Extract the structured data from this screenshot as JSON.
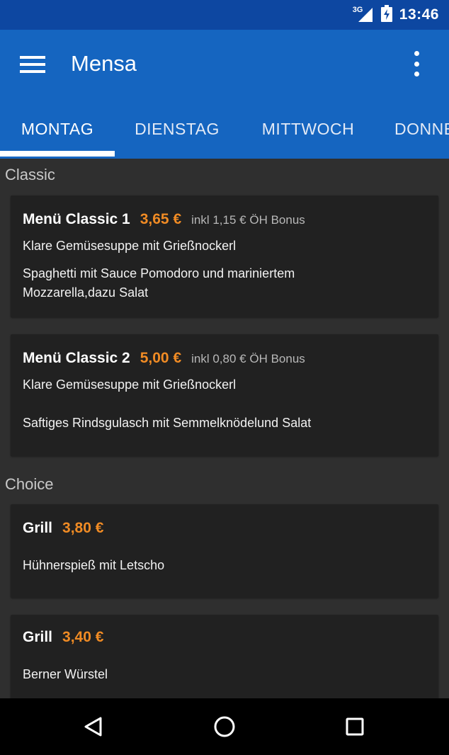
{
  "status_bar": {
    "network": "3G",
    "time": "13:46"
  },
  "app_bar": {
    "title": "Mensa",
    "menu_icon": "hamburger-menu-icon",
    "overflow_icon": "more-vertical-icon"
  },
  "tabs": [
    {
      "label": "MONTAG",
      "active": true
    },
    {
      "label": "DIENSTAG",
      "active": false
    },
    {
      "label": "MITTWOCH",
      "active": false
    },
    {
      "label": "DONNERSTAG",
      "active": false
    }
  ],
  "sections": [
    {
      "title": "Classic",
      "items": [
        {
          "name": "Menü Classic 1",
          "price": "3,65 €",
          "bonus": "inkl 1,15 € ÖH Bonus",
          "lines": [
            "Klare Gemüsesuppe mit Grießnockerl",
            "Spaghetti mit Sauce Pomodoro und mariniertem Mozzarella,dazu Salat"
          ]
        },
        {
          "name": "Menü Classic 2",
          "price": "5,00 €",
          "bonus": "inkl 0,80 € ÖH Bonus",
          "lines": [
            "Klare Gemüsesuppe mit Grießnockerl",
            "Saftiges Rindsgulasch mit Semmelknödelund Salat"
          ]
        }
      ]
    },
    {
      "title": "Choice",
      "items": [
        {
          "name": "Grill",
          "price": "3,80 €",
          "bonus": "",
          "lines": [
            "Hühnerspieß mit Letscho"
          ]
        },
        {
          "name": "Grill",
          "price": "3,40 €",
          "bonus": "",
          "lines": [
            "Berner Würstel"
          ]
        }
      ]
    }
  ],
  "nav_bar": {
    "back_icon": "back-triangle-icon",
    "home_icon": "home-circle-icon",
    "recents_icon": "recents-square-icon"
  },
  "colors": {
    "status_bar": "#0d47a1",
    "app_bar": "#1565c0",
    "background": "#2f2f2f",
    "card": "#212121",
    "price": "#f08b24"
  }
}
